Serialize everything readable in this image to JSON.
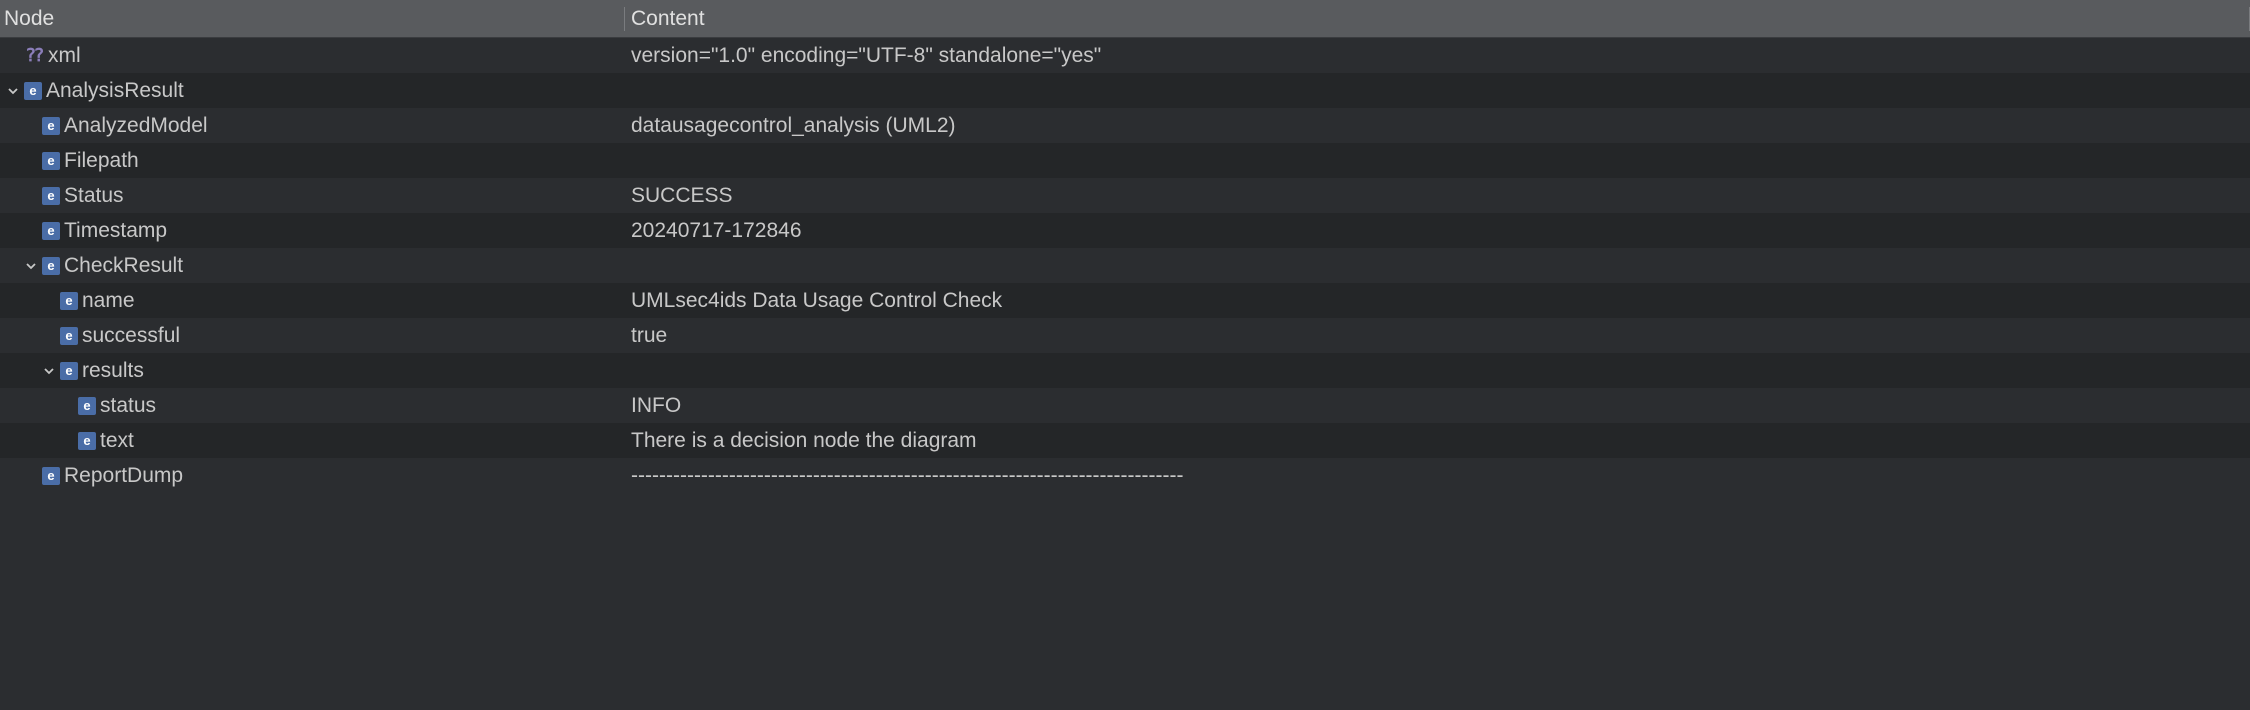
{
  "headers": {
    "node": "Node",
    "content": "Content"
  },
  "rows": [
    {
      "indent": 0,
      "chevron": null,
      "icon": "xml",
      "name": "xml-declaration",
      "label": "xml",
      "content": "version=\"1.0\" encoding=\"UTF-8\" standalone=\"yes\""
    },
    {
      "indent": 0,
      "chevron": "down",
      "icon": "element",
      "name": "analysis-result-node",
      "label": "AnalysisResult",
      "content": ""
    },
    {
      "indent": 1,
      "chevron": null,
      "icon": "element",
      "name": "analyzed-model-node",
      "label": "AnalyzedModel",
      "content": "datausagecontrol_analysis (UML2)"
    },
    {
      "indent": 1,
      "chevron": null,
      "icon": "element",
      "name": "filepath-node",
      "label": "Filepath",
      "content": ""
    },
    {
      "indent": 1,
      "chevron": null,
      "icon": "element",
      "name": "status-node",
      "label": "Status",
      "content": "SUCCESS"
    },
    {
      "indent": 1,
      "chevron": null,
      "icon": "element",
      "name": "timestamp-node",
      "label": "Timestamp",
      "content": "20240717-172846"
    },
    {
      "indent": 1,
      "chevron": "down",
      "icon": "element",
      "name": "check-result-node",
      "label": "CheckResult",
      "content": ""
    },
    {
      "indent": 2,
      "chevron": null,
      "icon": "element",
      "name": "name-node",
      "label": "name",
      "content": "UMLsec4ids Data Usage Control Check"
    },
    {
      "indent": 2,
      "chevron": null,
      "icon": "element",
      "name": "successful-node",
      "label": "successful",
      "content": "true"
    },
    {
      "indent": 2,
      "chevron": "down",
      "icon": "element",
      "name": "results-node",
      "label": "results",
      "content": ""
    },
    {
      "indent": 3,
      "chevron": null,
      "icon": "element",
      "name": "result-status-node",
      "label": "status",
      "content": "INFO"
    },
    {
      "indent": 3,
      "chevron": null,
      "icon": "element",
      "name": "result-text-node",
      "label": "text",
      "content": "There is a decision node the diagram"
    },
    {
      "indent": 1,
      "chevron": null,
      "icon": "element",
      "name": "report-dump-node",
      "label": "ReportDump",
      "content": "-------------------------------------------------------------------------------"
    }
  ]
}
